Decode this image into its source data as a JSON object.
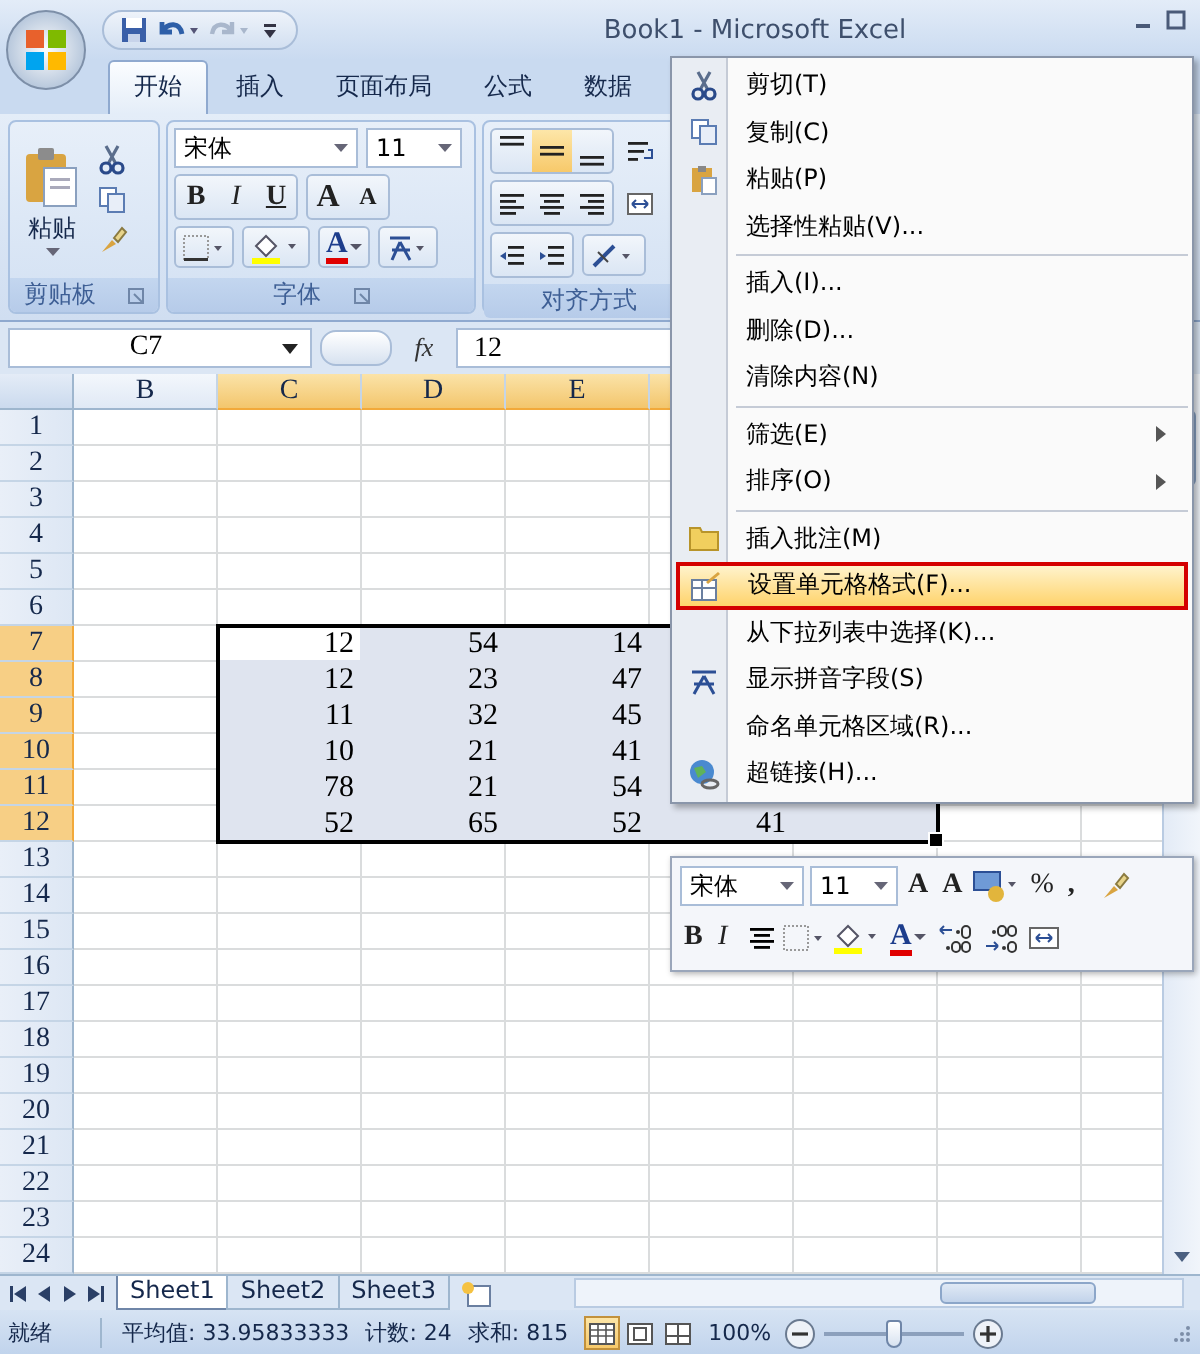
{
  "title_bar": {
    "title": "Book1 - Microsoft Excel"
  },
  "ribbon_tabs": [
    {
      "label": "开始",
      "selected": true
    },
    {
      "label": "插入",
      "selected": false
    },
    {
      "label": "页面布局",
      "selected": false
    },
    {
      "label": "公式",
      "selected": false
    },
    {
      "label": "数据",
      "selected": false
    }
  ],
  "ribbon": {
    "clipboard": {
      "label": "剪贴板",
      "paste_label": "粘贴"
    },
    "font": {
      "label": "字体",
      "font_name": "宋体",
      "font_size": "11",
      "styles": [
        {
          "label": "B",
          "kind": "bold"
        },
        {
          "label": "I",
          "kind": "italic"
        },
        {
          "label": "U",
          "kind": "underline"
        }
      ],
      "grow_label": "A",
      "shrink_label": "A",
      "font_color_label": "A"
    },
    "alignment": {
      "label": "对齐方式",
      "vertical": [
        {
          "kind": "top",
          "selected": false
        },
        {
          "kind": "middle",
          "selected": true
        },
        {
          "kind": "bottom",
          "selected": false
        }
      ]
    }
  },
  "formula_bar": {
    "name_box": "C7",
    "fx_label": "fx",
    "value": "12"
  },
  "grid": {
    "columns": [
      {
        "label": "B",
        "selected": false
      },
      {
        "label": "C",
        "selected": true
      },
      {
        "label": "D",
        "selected": true
      },
      {
        "label": "E",
        "selected": true
      },
      {
        "selected": true
      },
      {
        "selected": true
      }
    ],
    "rows": [
      {
        "label": "1",
        "selected": false
      },
      {
        "label": "2",
        "selected": false
      },
      {
        "label": "3",
        "selected": false
      },
      {
        "label": "4",
        "selected": false
      },
      {
        "label": "5",
        "selected": false
      },
      {
        "label": "6",
        "selected": false
      },
      {
        "label": "7",
        "selected": true,
        "cells": [
          null,
          "12",
          "54",
          "14"
        ]
      },
      {
        "label": "8",
        "selected": true,
        "cells": [
          null,
          "12",
          "23",
          "47"
        ]
      },
      {
        "label": "9",
        "selected": true,
        "cells": [
          null,
          "11",
          "32",
          "45"
        ]
      },
      {
        "label": "10",
        "selected": true,
        "cells": [
          null,
          "10",
          "21",
          "41"
        ]
      },
      {
        "label": "11",
        "selected": true,
        "cells": [
          null,
          "78",
          "21",
          "54"
        ]
      },
      {
        "label": "12",
        "selected": true,
        "cells": [
          null,
          "52",
          "65",
          "52",
          "41"
        ]
      },
      {
        "label": "13",
        "selected": false
      },
      {
        "label": "14",
        "selected": false
      },
      {
        "label": "15",
        "selected": false
      },
      {
        "label": "16",
        "selected": false
      },
      {
        "label": "17",
        "selected": false
      },
      {
        "label": "18",
        "selected": false
      },
      {
        "label": "19",
        "selected": false
      },
      {
        "label": "20",
        "selected": false
      },
      {
        "label": "21",
        "selected": false
      },
      {
        "label": "22",
        "selected": false
      },
      {
        "label": "23",
        "selected": false
      },
      {
        "label": "24",
        "selected": false
      }
    ]
  },
  "sheet_tabs": [
    {
      "label": "Sheet1",
      "selected": true
    },
    {
      "label": "Sheet2",
      "selected": false
    },
    {
      "label": "Sheet3",
      "selected": false
    }
  ],
  "status_bar": {
    "mode": "就绪",
    "average": "平均值: 33.95833333",
    "count": "计数: 24",
    "sum": "求和: 815",
    "views": [
      {
        "kind": "normal",
        "selected": true
      },
      {
        "kind": "layout",
        "selected": false
      },
      {
        "kind": "pagebreak",
        "selected": false
      }
    ],
    "zoom_label": "100%",
    "zoom": {
      "level": 0.5
    }
  },
  "context_menu": [
    {
      "kind": "cut",
      "label": "剪切(T)",
      "selected": false
    },
    {
      "kind": "copy",
      "label": "复制(C)",
      "selected": false
    },
    {
      "kind": "paste",
      "label": "粘贴(P)",
      "selected": false
    },
    {
      "kind": "plain",
      "label": "选择性粘贴(V)...",
      "selected": false
    },
    {
      "kind": "separator"
    },
    {
      "kind": "plain",
      "label": "插入(I)...",
      "selected": false
    },
    {
      "kind": "plain",
      "label": "删除(D)...",
      "selected": false
    },
    {
      "kind": "plain",
      "label": "清除内容(N)",
      "selected": false
    },
    {
      "kind": "separator"
    },
    {
      "kind": "submenu",
      "label": "筛选(E)",
      "selected": false
    },
    {
      "kind": "submenu",
      "label": "排序(O)",
      "selected": false
    },
    {
      "kind": "separator"
    },
    {
      "kind": "comment",
      "label": "插入批注(M)",
      "selected": false
    },
    {
      "kind": "format",
      "label": "设置单元格格式(F)...",
      "selected": true
    },
    {
      "kind": "plain",
      "label": "从下拉列表中选择(K)...",
      "selected": false
    },
    {
      "kind": "phonetic",
      "label": "显示拼音字段(S)",
      "selected": false
    },
    {
      "kind": "plain",
      "label": "命名单元格区域(R)...",
      "selected": false
    },
    {
      "kind": "link",
      "label": "超链接(H)...",
      "selected": false
    }
  ],
  "mini_toolbar": {
    "font_name": "宋体",
    "font_size": "11",
    "grow_label": "A",
    "shrink_label": "A",
    "percent_label": "%",
    "comma_label": ",",
    "bold_label": "B",
    "italic_label": "I",
    "font_color_label": "A"
  }
}
